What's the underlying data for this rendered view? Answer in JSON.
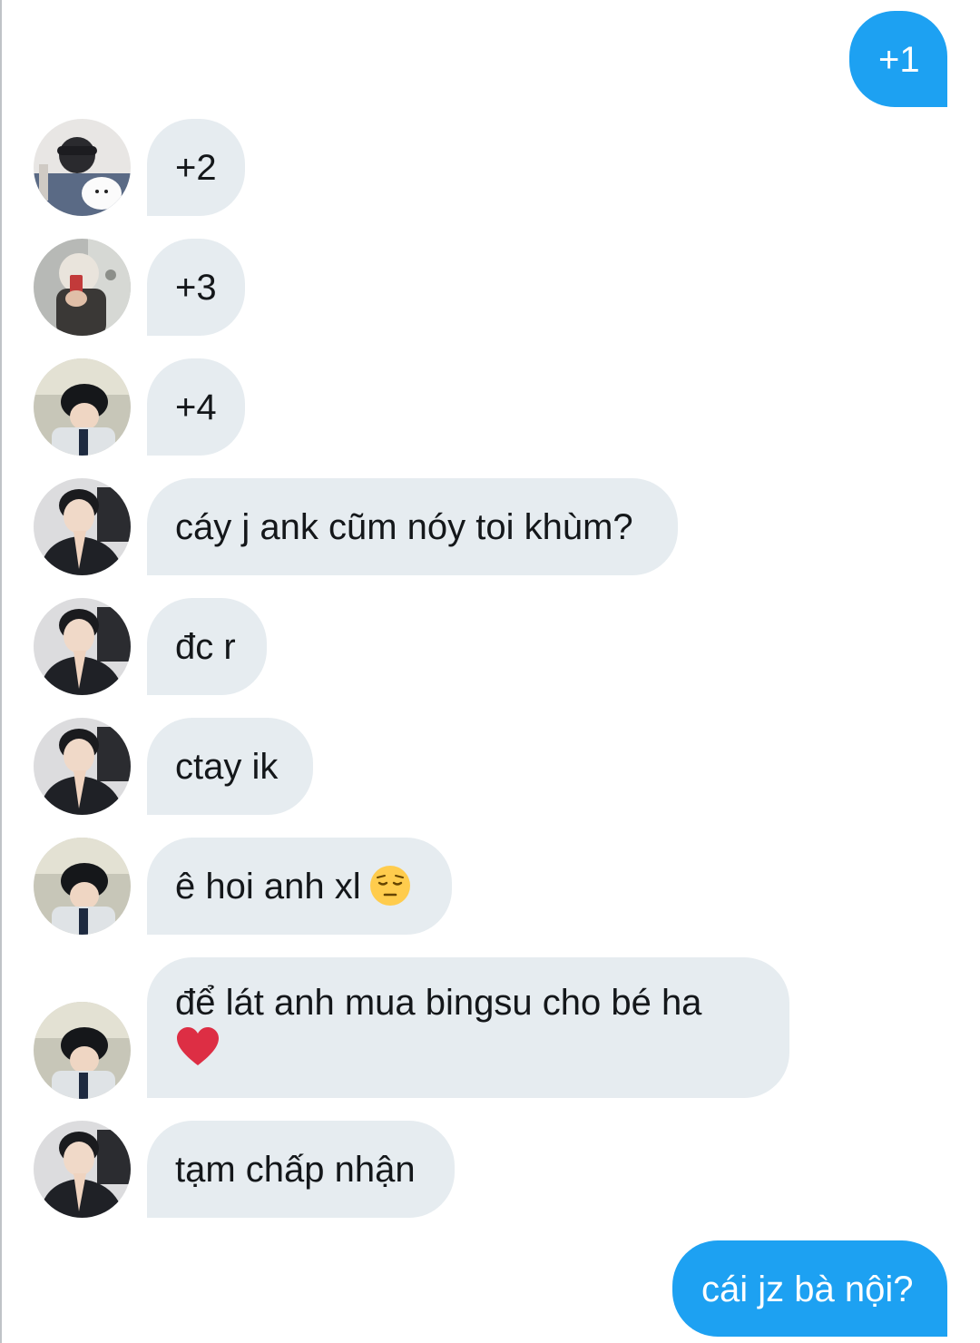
{
  "conversation": {
    "messages": [
      {
        "side": "sent",
        "text": "+1"
      },
      {
        "side": "received",
        "avatar": "avatar-user-cap-dog",
        "text": "+2"
      },
      {
        "side": "received",
        "avatar": "avatar-user-selfie",
        "text": "+3"
      },
      {
        "side": "received",
        "avatar": "avatar-user-lying",
        "text": "+4"
      },
      {
        "side": "received",
        "avatar": "avatar-user-praying",
        "text": "cáy j ank cũm nóy toi khùm?"
      },
      {
        "side": "received",
        "avatar": "avatar-user-praying",
        "text": "đc r"
      },
      {
        "side": "received",
        "avatar": "avatar-user-praying",
        "text": "ctay ik"
      },
      {
        "side": "received",
        "avatar": "avatar-user-lying",
        "text": "ê hoi anh xl",
        "emoji": "pensive-face-icon"
      },
      {
        "side": "received",
        "avatar": "avatar-user-lying",
        "text": "để lát anh mua bingsu cho bé ha",
        "emoji": "red-heart-icon"
      },
      {
        "side": "received",
        "avatar": "avatar-user-praying",
        "text": "tạm chấp nhận"
      },
      {
        "side": "sent",
        "text": "cái jz bà nội?"
      }
    ]
  },
  "colors": {
    "sent_bubble": "#1da1f2",
    "received_bubble": "#e6ecf0",
    "received_text": "#14171a",
    "sent_text": "#ffffff"
  }
}
